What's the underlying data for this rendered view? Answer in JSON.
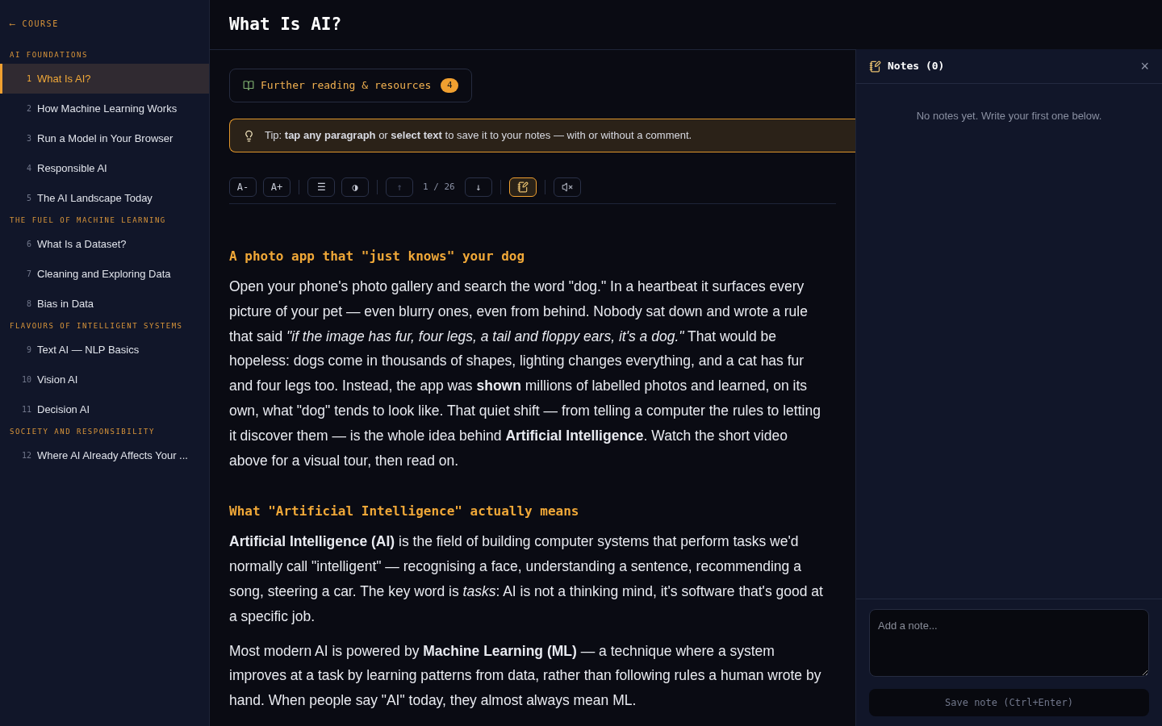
{
  "sidebar": {
    "back_link": {
      "arrow": "⟵",
      "label": "COURSE"
    },
    "sections": [
      {
        "title": "AI FOUNDATIONS",
        "items": [
          {
            "number": "1",
            "label": "What Is AI?",
            "selected": true
          },
          {
            "number": "2",
            "label": "How Machine Learning Works",
            "selected": false
          },
          {
            "number": "3",
            "label": "Run a Model in Your Browser",
            "selected": false
          },
          {
            "number": "4",
            "label": "Responsible AI",
            "selected": false
          },
          {
            "number": "5",
            "label": "The AI Landscape Today",
            "selected": false
          }
        ]
      },
      {
        "title": "THE FUEL OF MACHINE LEARNING",
        "items": [
          {
            "number": "6",
            "label": "What Is a Dataset?",
            "selected": false
          },
          {
            "number": "7",
            "label": "Cleaning and Exploring Data",
            "selected": false
          },
          {
            "number": "8",
            "label": "Bias in Data",
            "selected": false
          }
        ]
      },
      {
        "title": "FLAVOURS OF INTELLIGENT SYSTEMS",
        "items": [
          {
            "number": "9",
            "label": "Text AI — NLP Basics",
            "selected": false
          },
          {
            "number": "10",
            "label": "Vision AI",
            "selected": false
          },
          {
            "number": "11",
            "label": "Decision AI",
            "selected": false
          }
        ]
      },
      {
        "title": "SOCIETY AND RESPONSIBILITY",
        "items": [
          {
            "number": "12",
            "label": "Where AI Already Affects Your ...",
            "selected": false
          }
        ]
      }
    ]
  },
  "page_title": "What Is AI?",
  "resources_button": {
    "label": "Further reading & resources",
    "count": "4"
  },
  "tip": "Tip: **tap any paragraph** or **select text** to save it to your notes — with or without a comment.",
  "toolbar": [
    [
      {
        "kind": "text",
        "label": "A-",
        "disabled": false,
        "selected": false
      },
      {
        "kind": "text",
        "label": "A+",
        "disabled": false,
        "selected": false
      }
    ],
    [
      {
        "kind": "text",
        "label": "☰",
        "disabled": false,
        "selected": false
      },
      {
        "kind": "text",
        "label": "◑",
        "disabled": false,
        "selected": false
      }
    ],
    [
      {
        "kind": "text",
        "label": "↑",
        "disabled": true,
        "selected": false
      },
      {
        "kind": "counter",
        "label": "1 / 26"
      },
      {
        "kind": "text",
        "label": "↓",
        "disabled": false,
        "selected": false
      }
    ],
    [
      {
        "kind": "notes",
        "selected": true
      }
    ],
    [
      {
        "kind": "audio",
        "selected": false
      }
    ]
  ],
  "article": [
    {
      "kind": "heading",
      "text": "A photo app that \"just knows\" your dog"
    },
    {
      "kind": "paragraph",
      "text": "Open your phone's photo gallery and search the word \"dog.\" In a heartbeat it surfaces every picture of your pet — even blurry ones, even from behind. Nobody sat down and wrote a rule that said *\"if the image has fur, four legs, a tail and floppy ears, it's a dog.\"* That would be hopeless: dogs come in thousands of shapes, lighting changes everything, and a cat has fur and four legs too. Instead, the app was **shown** millions of labelled photos and learned, on its own, what \"dog\" tends to look like. That quiet shift — from telling a computer the rules to letting it discover them — is the whole idea behind **Artificial Intelligence**. Watch the short video above for a visual tour, then read on."
    },
    {
      "kind": "heading",
      "text": "What \"Artificial Intelligence\" actually means"
    },
    {
      "kind": "paragraph",
      "text": "**Artificial Intelligence (AI)** is the field of building computer systems that perform tasks we'd normally call \"intelligent\" — recognising a face, understanding a sentence, recommending a song, steering a car. The key word is *tasks*: AI is not a thinking mind, it's software that's good at a specific job."
    },
    {
      "kind": "paragraph",
      "text": "Most modern AI is powered by **Machine Learning (ML)** — a technique where a system improves at a task by learning patterns from data, rather than following rules a human wrote by hand. When people say \"AI\" today, they almost always mean ML."
    }
  ],
  "notes": {
    "title": "Notes (0)",
    "close": "×",
    "empty": "No notes yet. Write your first one below.",
    "placeholder": "Add a note...",
    "save_button": "Save note (Ctrl+Enter)"
  }
}
